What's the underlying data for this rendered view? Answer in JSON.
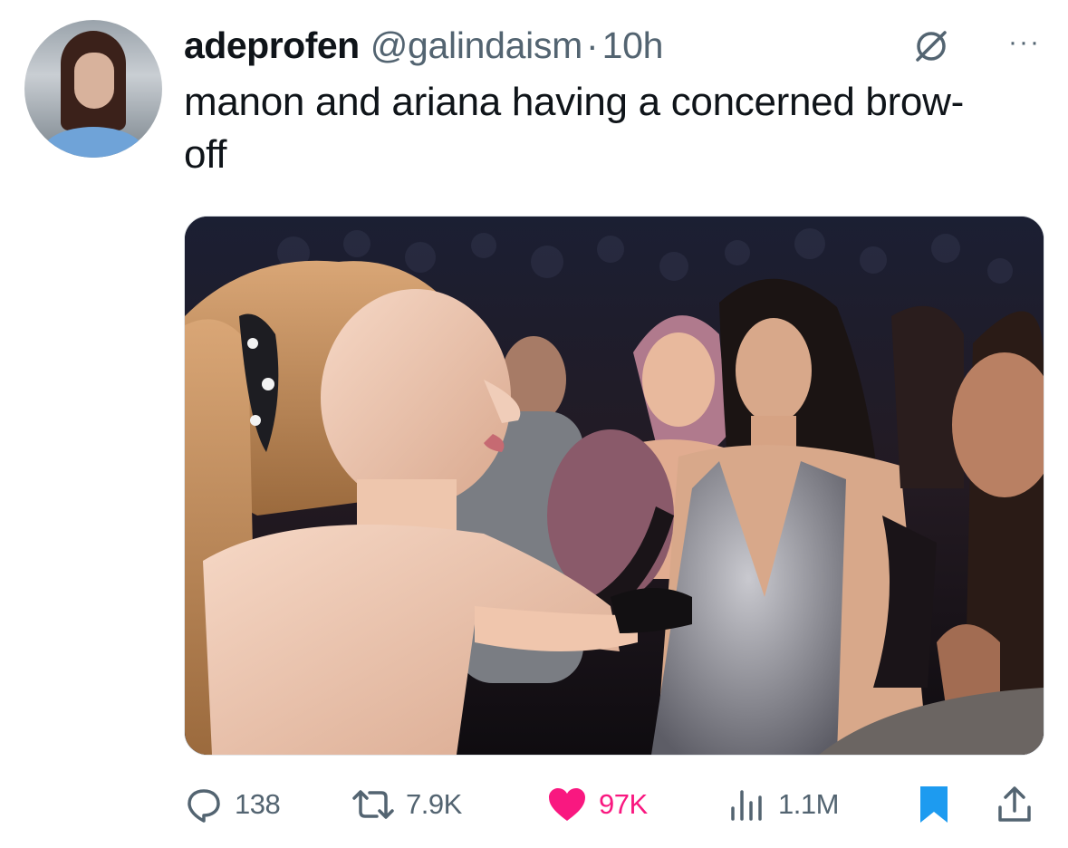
{
  "tweet": {
    "display_name": "adeprofen",
    "handle": "@galindaism",
    "separator": "·",
    "time": "10h",
    "more_label": "···",
    "text": "manon and ariana having a concerned brow-off"
  },
  "media": {
    "description_icon": "photo"
  },
  "actions": {
    "replies": "138",
    "reposts": "7.9K",
    "likes": "97K",
    "views": "1.1M"
  },
  "colors": {
    "like": "#f91880",
    "bookmark": "#1d9bf0",
    "secondary": "#536471"
  },
  "icons": [
    "reply-icon",
    "repost-icon",
    "like-icon",
    "views-icon",
    "bookmark-icon",
    "share-icon",
    "badge-icon",
    "more-icon"
  ]
}
